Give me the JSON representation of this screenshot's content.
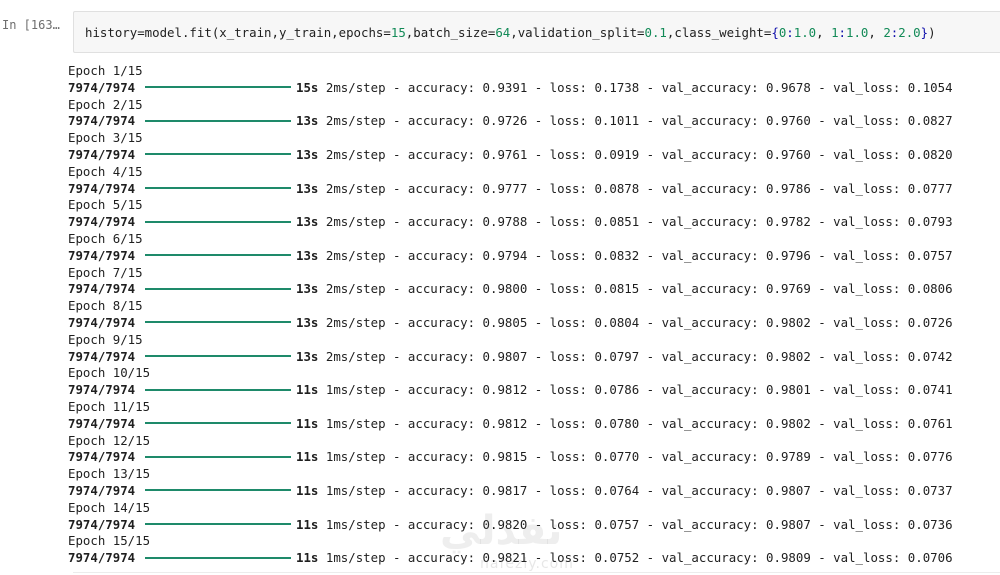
{
  "cell": {
    "prompt": "In [163…",
    "code": {
      "prefix": "history=model.fit(x_train,y_train,epochs=",
      "epochs": "15",
      "mid1": ",batch_size=",
      "batch_size": "64",
      "mid2": ",validation_split=",
      "validation_split": "0.1",
      "mid3": ",class_weight=",
      "class_weight_open": "{",
      "cw_k0": "0",
      "cw_colon0": ":",
      "cw_v0": "1.0",
      "cw_sep0": ", ",
      "cw_k1": "1",
      "cw_colon1": ":",
      "cw_v1": "1.0",
      "cw_sep1": ", ",
      "cw_k2": "2",
      "cw_colon2": ":",
      "cw_v2": "2.0",
      "class_weight_close": "}",
      "suffix": ")"
    }
  },
  "output": {
    "epochs": [
      {
        "label": "Epoch 1/15",
        "steps": "7974/7974",
        "time": "15s",
        "per_step": "2ms/step",
        "accuracy": "0.9391",
        "loss": "0.1738",
        "val_accuracy": "0.9678",
        "val_loss": "0.1054"
      },
      {
        "label": "Epoch 2/15",
        "steps": "7974/7974",
        "time": "13s",
        "per_step": "2ms/step",
        "accuracy": "0.9726",
        "loss": "0.1011",
        "val_accuracy": "0.9760",
        "val_loss": "0.0827"
      },
      {
        "label": "Epoch 3/15",
        "steps": "7974/7974",
        "time": "13s",
        "per_step": "2ms/step",
        "accuracy": "0.9761",
        "loss": "0.0919",
        "val_accuracy": "0.9760",
        "val_loss": "0.0820"
      },
      {
        "label": "Epoch 4/15",
        "steps": "7974/7974",
        "time": "13s",
        "per_step": "2ms/step",
        "accuracy": "0.9777",
        "loss": "0.0878",
        "val_accuracy": "0.9786",
        "val_loss": "0.0777"
      },
      {
        "label": "Epoch 5/15",
        "steps": "7974/7974",
        "time": "13s",
        "per_step": "2ms/step",
        "accuracy": "0.9788",
        "loss": "0.0851",
        "val_accuracy": "0.9782",
        "val_loss": "0.0793"
      },
      {
        "label": "Epoch 6/15",
        "steps": "7974/7974",
        "time": "13s",
        "per_step": "2ms/step",
        "accuracy": "0.9794",
        "loss": "0.0832",
        "val_accuracy": "0.9796",
        "val_loss": "0.0757"
      },
      {
        "label": "Epoch 7/15",
        "steps": "7974/7974",
        "time": "13s",
        "per_step": "2ms/step",
        "accuracy": "0.9800",
        "loss": "0.0815",
        "val_accuracy": "0.9769",
        "val_loss": "0.0806"
      },
      {
        "label": "Epoch 8/15",
        "steps": "7974/7974",
        "time": "13s",
        "per_step": "2ms/step",
        "accuracy": "0.9805",
        "loss": "0.0804",
        "val_accuracy": "0.9802",
        "val_loss": "0.0726"
      },
      {
        "label": "Epoch 9/15",
        "steps": "7974/7974",
        "time": "13s",
        "per_step": "2ms/step",
        "accuracy": "0.9807",
        "loss": "0.0797",
        "val_accuracy": "0.9802",
        "val_loss": "0.0742"
      },
      {
        "label": "Epoch 10/15",
        "steps": "7974/7974",
        "time": "11s",
        "per_step": "1ms/step",
        "accuracy": "0.9812",
        "loss": "0.0786",
        "val_accuracy": "0.9801",
        "val_loss": "0.0741"
      },
      {
        "label": "Epoch 11/15",
        "steps": "7974/7974",
        "time": "11s",
        "per_step": "1ms/step",
        "accuracy": "0.9812",
        "loss": "0.0780",
        "val_accuracy": "0.9802",
        "val_loss": "0.0761"
      },
      {
        "label": "Epoch 12/15",
        "steps": "7974/7974",
        "time": "11s",
        "per_step": "1ms/step",
        "accuracy": "0.9815",
        "loss": "0.0770",
        "val_accuracy": "0.9789",
        "val_loss": "0.0776"
      },
      {
        "label": "Epoch 13/15",
        "steps": "7974/7974",
        "time": "11s",
        "per_step": "1ms/step",
        "accuracy": "0.9817",
        "loss": "0.0764",
        "val_accuracy": "0.9807",
        "val_loss": "0.0737"
      },
      {
        "label": "Epoch 14/15",
        "steps": "7974/7974",
        "time": "11s",
        "per_step": "1ms/step",
        "accuracy": "0.9820",
        "loss": "0.0757",
        "val_accuracy": "0.9807",
        "val_loss": "0.0736"
      },
      {
        "label": "Epoch 15/15",
        "steps": "7974/7974",
        "time": "11s",
        "per_step": "1ms/step",
        "accuracy": "0.9821",
        "loss": "0.0752",
        "val_accuracy": "0.9809",
        "val_loss": "0.0706"
      }
    ],
    "metric_labels": {
      "accuracy": " - accuracy: ",
      "loss": " - loss: ",
      "val_accuracy": " - val_accuracy: ",
      "val_loss": " - val_loss: "
    }
  },
  "watermark": {
    "arabic": "نفذلي",
    "latin": "nafezly.com"
  },
  "colors": {
    "progress_bar": "#1e8a6a",
    "number_literal": "#128a57",
    "punctuation": "#0e0eab"
  }
}
